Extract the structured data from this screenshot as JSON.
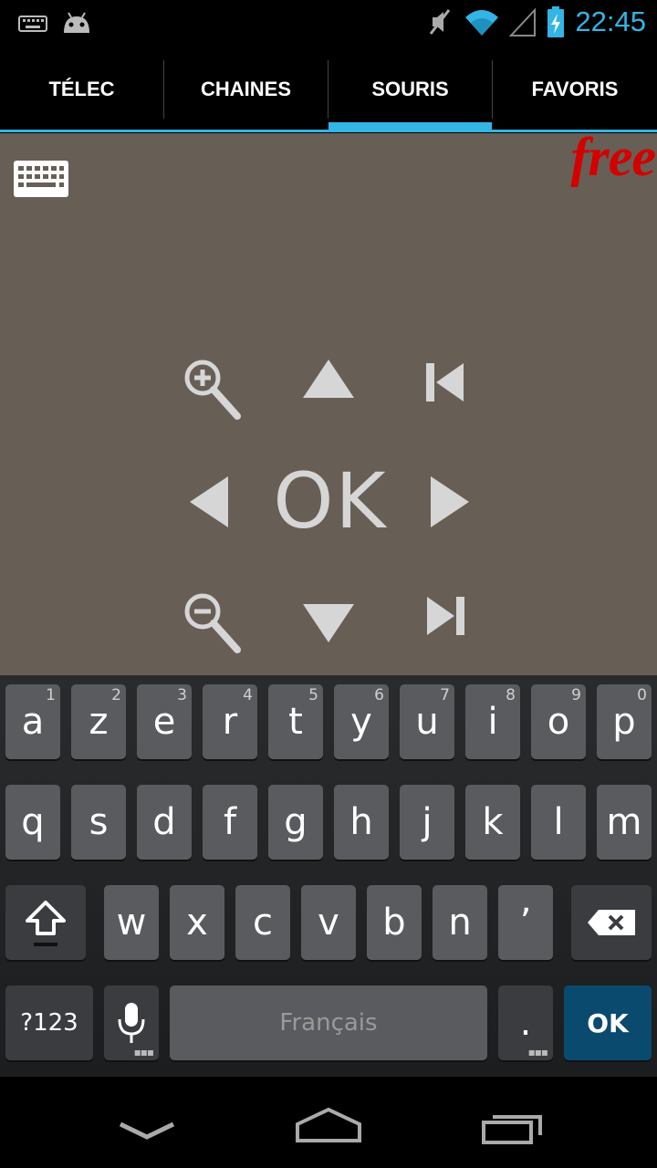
{
  "status_bar": {
    "time": "22:45",
    "icons": [
      "keyboard-notification-icon",
      "android-debug-icon",
      "mute-icon",
      "wifi-icon",
      "signal-icon",
      "battery-charging-icon"
    ]
  },
  "tabs": [
    {
      "label": "TÉLEC",
      "active": false
    },
    {
      "label": "CHAINES",
      "active": false
    },
    {
      "label": "SOURIS",
      "active": true
    },
    {
      "label": "FAVORIS",
      "active": false
    }
  ],
  "touchpad": {
    "logo": "free",
    "ok_label": "OK"
  },
  "keyboard": {
    "row1": [
      {
        "label": "a",
        "hint": "1"
      },
      {
        "label": "z",
        "hint": "2"
      },
      {
        "label": "e",
        "hint": "3"
      },
      {
        "label": "r",
        "hint": "4"
      },
      {
        "label": "t",
        "hint": "5"
      },
      {
        "label": "y",
        "hint": "6"
      },
      {
        "label": "u",
        "hint": "7"
      },
      {
        "label": "i",
        "hint": "8"
      },
      {
        "label": "o",
        "hint": "9"
      },
      {
        "label": "p",
        "hint": "0"
      }
    ],
    "row2": [
      {
        "label": "q"
      },
      {
        "label": "s"
      },
      {
        "label": "d"
      },
      {
        "label": "f"
      },
      {
        "label": "g"
      },
      {
        "label": "h"
      },
      {
        "label": "j"
      },
      {
        "label": "k"
      },
      {
        "label": "l"
      },
      {
        "label": "m"
      }
    ],
    "row3": [
      {
        "label": "w"
      },
      {
        "label": "x"
      },
      {
        "label": "c"
      },
      {
        "label": "v"
      },
      {
        "label": "b"
      },
      {
        "label": "n"
      },
      {
        "label": "’"
      }
    ],
    "symbols_label": "?123",
    "space_label": "Français",
    "period_label": ".",
    "enter_label": "OK"
  },
  "colors": {
    "accent": "#33b5e5",
    "touchpad_bg": "#675e55",
    "logo_red": "#d40000",
    "key_bg": "#5a5b5e",
    "enter_bg": "#0b4a6f"
  }
}
